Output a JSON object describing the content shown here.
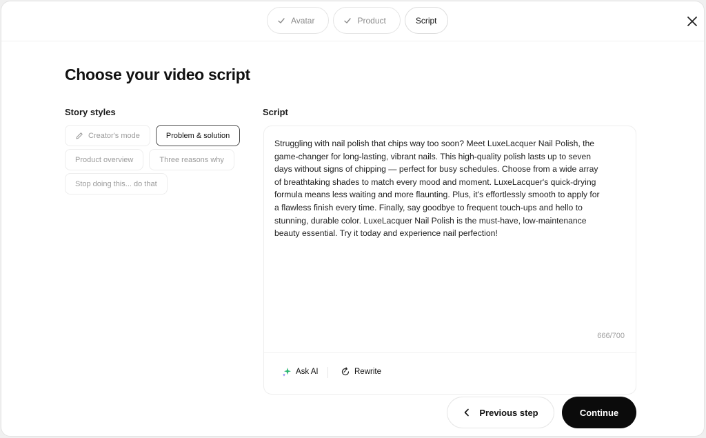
{
  "stepper": {
    "steps": [
      {
        "label": "Avatar",
        "state": "done"
      },
      {
        "label": "Product",
        "state": "done"
      },
      {
        "label": "Script",
        "state": "active"
      }
    ]
  },
  "page": {
    "title": "Choose your video script"
  },
  "story_styles": {
    "label": "Story styles",
    "options": [
      {
        "label": "Creator's mode",
        "icon": "pencil-icon",
        "selected": false
      },
      {
        "label": "Problem & solution",
        "selected": true
      },
      {
        "label": "Product overview",
        "selected": false
      },
      {
        "label": "Three reasons why",
        "selected": false
      },
      {
        "label": "Stop doing this... do that",
        "selected": false
      }
    ]
  },
  "script": {
    "label": "Script",
    "text": "Struggling with nail polish that chips way too soon? Meet LuxeLacquer Nail Polish, the game-changer for long-lasting, vibrant nails. This high-quality polish lasts up to seven days without signs of chipping — perfect for busy schedules. Choose from a wide array of breathtaking shades to match every mood and moment. LuxeLacquer's quick-drying formula means less waiting and more flaunting. Plus, it's effortlessly smooth to apply for a flawless finish every time. Finally, say goodbye to frequent touch-ups and hello to stunning, durable color. LuxeLacquer Nail Polish is the must-have, low-maintenance beauty essential. Try it today and experience nail perfection!",
    "char_count": "666/700",
    "tools": {
      "ask_ai_label": "Ask AI",
      "rewrite_label": "Rewrite"
    }
  },
  "footer": {
    "previous_label": "Previous step",
    "continue_label": "Continue"
  },
  "colors": {
    "primary_button_bg": "#0b0b0b",
    "ask_ai_accent": "#2bb673"
  }
}
